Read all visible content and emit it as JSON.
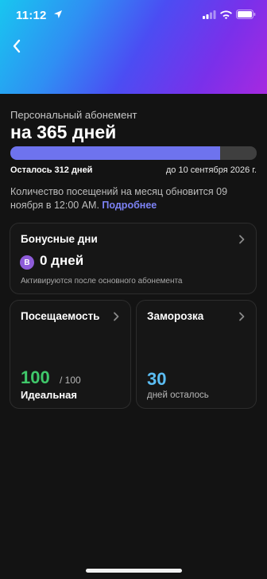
{
  "status_bar": {
    "time": "11:12"
  },
  "subscription": {
    "type_label": "Персональный абонемент",
    "name": "на 365 дней",
    "progress_fraction": 0.85,
    "remaining": "Осталось 312 дней",
    "until": "до 10 сентября 2026 г.",
    "note": "Количество посещений на месяц обновится 09 ноября в 12:00 AM.",
    "note_link": "Подробнее"
  },
  "bonus_card": {
    "title": "Бонусные дни",
    "badge": "B",
    "value": "0 дней",
    "subtitle": "Активируются после основного абонемента"
  },
  "attendance_card": {
    "title": "Посещаемость",
    "value": "100",
    "max": "/ 100",
    "label": "Идеальная"
  },
  "freeze_card": {
    "title": "Заморозка",
    "value": "30",
    "label": "дней осталось"
  },
  "colors": {
    "progress": "#6e73ee",
    "attendance": "#3fc86a",
    "freeze": "#5bbdf3",
    "link": "#7c82f5",
    "bonus_badge": "#8e5cd9"
  }
}
